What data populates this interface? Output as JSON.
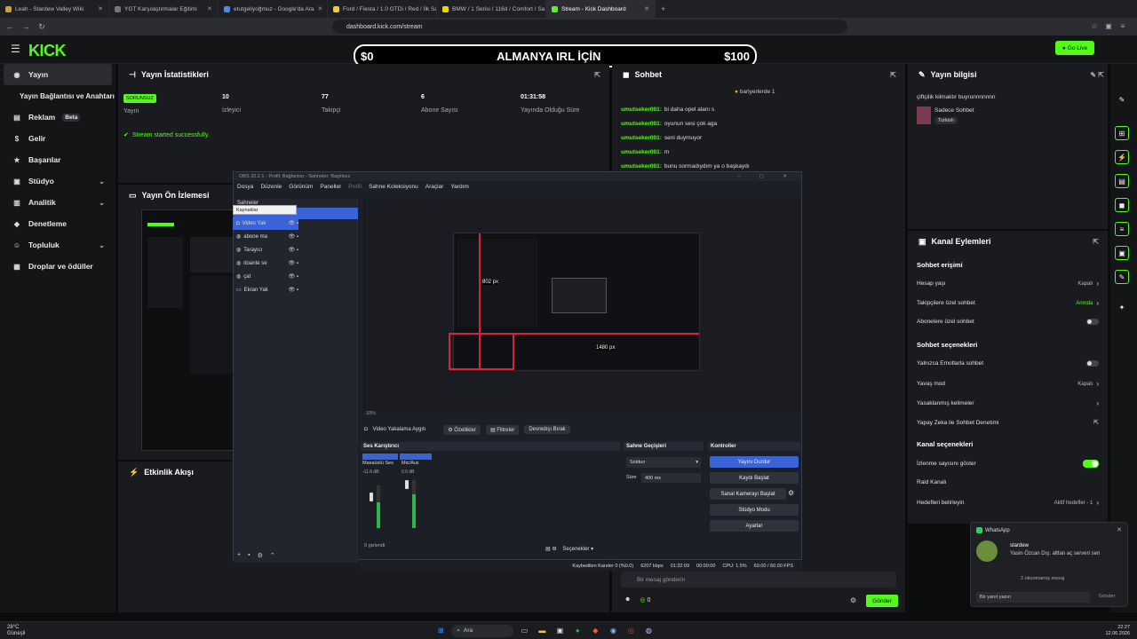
{
  "browser": {
    "tabs": [
      {
        "title": "Leah - Stardew Valley Wiki",
        "color": "#c9a43a"
      },
      {
        "title": "YGT Karşılaştırmalar Eğitimi",
        "color": "#777"
      },
      {
        "title": "etutgeliyoğmuz - Google'da Ara",
        "color": "#4a8af4"
      },
      {
        "title": "Ford / Fiesta / 1.0 GTDi / Red / İlk Sa",
        "color": "#f5d300"
      },
      {
        "title": "BMW / 1 Serisi / 116d / Comfort / Sa",
        "color": "#f5d300"
      },
      {
        "title": "Stream - Kick Dashboard",
        "color": "#53fc18"
      }
    ],
    "url": "dashboard.kick.com/stream"
  },
  "header": {
    "logo": "KICK",
    "banner_left": "$0",
    "banner_title": "ALMANYA IRL İÇİN",
    "banner_right": "$100",
    "golive_label": "Go Live"
  },
  "sidebar": {
    "items": [
      {
        "label": "Yayın",
        "icon": "broadcast-icon",
        "glyph": "◉",
        "active": true
      },
      {
        "label": "Yayın Bağlantısı ve Anahtarı",
        "sub": true
      },
      {
        "label": "Reklam",
        "icon": "ad-icon",
        "glyph": "▤",
        "badge": "Beta"
      },
      {
        "label": "Gelir",
        "icon": "revenue-icon",
        "glyph": "$"
      },
      {
        "label": "Başarılar",
        "icon": "trophy-icon",
        "glyph": "★"
      },
      {
        "label": "Stüdyo",
        "icon": "studio-icon",
        "glyph": "▣",
        "chev": true
      },
      {
        "label": "Analitik",
        "icon": "chart-icon",
        "glyph": "▥",
        "chev": true
      },
      {
        "label": "Denetleme",
        "icon": "shield-icon",
        "glyph": "◆"
      },
      {
        "label": "Topluluk",
        "icon": "users-icon",
        "glyph": "☺",
        "chev": true
      },
      {
        "label": "Droplar ve ödüller",
        "icon": "gift-icon",
        "glyph": "▦"
      }
    ]
  },
  "stats": {
    "title": "Yayın İstatistikleri",
    "status_badge": "SORUNSUZ",
    "status_label": "Yayın",
    "items": [
      {
        "value": "10",
        "label": "İzleyici"
      },
      {
        "value": "77",
        "label": "Takipçi"
      },
      {
        "value": "6",
        "label": "Abone Sayısı"
      },
      {
        "value": "01:31:58",
        "label": "Yayında Olduğu Süre"
      }
    ],
    "started": "Stream started successfully."
  },
  "preview": {
    "title": "Yayın Ön İzlemesi"
  },
  "events": {
    "title": "Etkinlik Akışı"
  },
  "chat": {
    "title": "Sohbet",
    "pinned": "barlyerlerde 1",
    "messages": [
      {
        "user": "umutseker001:",
        "text": "bi daha opel alanı s"
      },
      {
        "user": "umutseker001:",
        "text": "oyunun sesi çok aga"
      },
      {
        "user": "umutseker001:",
        "text": "seni duymuyor"
      },
      {
        "user": "umutseker001:",
        "text": "m"
      },
      {
        "user": "umutseker001:",
        "text": "bunu sormadıydım ya o başkaydı"
      }
    ],
    "input_placeholder": "Bir mesaj gönderin",
    "send_label": "Gönder",
    "count": "0"
  },
  "info": {
    "title": "Yayın bilgisi",
    "stream_title": "çiftçilik kilmaktır buyrunnnnnnn",
    "category": "Sadece Sohbet",
    "language": "Turkish"
  },
  "actions": {
    "title": "Kanal Eylemleri",
    "chat_access": "Sohbet erişimi",
    "rows1": [
      {
        "label": "Hesap yaşı",
        "value": "Kapalı",
        "kind": "chev"
      },
      {
        "label": "Takipçilere özel sohbet",
        "value": "Anında",
        "kind": "chev",
        "green": true
      },
      {
        "label": "Abonelere özel sohbet",
        "value": "",
        "kind": "toggle"
      }
    ],
    "chat_options": "Sohbet seçenekleri",
    "rows2": [
      {
        "label": "Yalnızca Emotlarla sohbet",
        "value": "",
        "kind": "toggle"
      },
      {
        "label": "Yavaş mod",
        "value": "Kapalı",
        "kind": "chev"
      },
      {
        "label": "Yasaklanmış kelimeler",
        "value": "",
        "kind": "chev"
      },
      {
        "label": "Yapay Zeka ile Sohbet Denetimi",
        "value": "",
        "kind": "ext"
      }
    ],
    "channel_options": "Kanal seçenekleri",
    "rows3": [
      {
        "label": "İzlenme sayısını göster",
        "value": "",
        "kind": "toggle-on"
      },
      {
        "label": "Raid Kanalı",
        "value": "",
        "kind": "none"
      },
      {
        "label": "Hedefleri belirleyin",
        "value": "Aktif hedefler - 1",
        "kind": "chev"
      }
    ]
  },
  "obs": {
    "title": "OBS 32.2.1 - Profil: Bağlantısı - Sahneler: Başlıksız",
    "menu": [
      "Dosya",
      "Düzenle",
      "Görünüm",
      "Paneller",
      "Profil",
      "Sahne Koleksiyonu",
      "Araçlar",
      "Yardım"
    ],
    "scenes_label": "Sahneler",
    "sources_tip": "Kaynaklar",
    "sources": [
      {
        "name": "Video Yak",
        "icon": "camera-icon",
        "glyph": "◘",
        "selected": true
      },
      {
        "name": "abone ma",
        "icon": "globe-icon",
        "glyph": "◍"
      },
      {
        "name": "Tarayıcı",
        "icon": "globe-icon",
        "glyph": "◍"
      },
      {
        "name": "doante se",
        "icon": "globe-icon",
        "glyph": "◍"
      },
      {
        "name": "çat",
        "icon": "globe-icon",
        "glyph": "◍"
      },
      {
        "name": "Ekran Yak",
        "icon": "monitor-icon",
        "glyph": "▭"
      }
    ],
    "canvas_label_1": "802 px",
    "canvas_label_2": "1480 px",
    "zoom": "33%",
    "toolbar": {
      "source_name": "Video Yakalama Aygıtı",
      "properties": "Özellikler",
      "filters": "Filtreler",
      "deactivate": "Devredışı Bırak"
    },
    "mixer": {
      "title": "Ses Karıştırıcı",
      "ch1": "Masaüstü Ses",
      "ch2": "Mic/Aux",
      "ch1_db": "-11.6 dB",
      "ch2_db": "0.0 dB",
      "hidden": "0 gizlendi"
    },
    "transitions": {
      "title": "Sahne Geçişleri",
      "type": "Solduır",
      "duration_label": "Süre",
      "duration": "400 ms"
    },
    "controls": {
      "title": "Kontroller",
      "buttons": [
        "Yayını Durdur",
        "Kaydı Başlat",
        "Sanal Kamerayı Başlat",
        "Stüdyo Modu",
        "Ayarlar"
      ]
    },
    "options_label": "Seçenekler",
    "status": {
      "dropped": "Kaybedilen Kareler 0 (%0.0)",
      "bitrate": "6207 kbps",
      "live_time": "01:32:09",
      "rec_time": "00:00:00",
      "cpu": "CPU: 1.5%",
      "fps": "60.00 / 60.00 FPS"
    }
  },
  "whatsapp": {
    "app": "WhatsApp",
    "sender": "stardew",
    "message": "Yasin Özcan Dış: alttan aç serveri sen",
    "unread": "2 okunmamış mesaj",
    "reply_placeholder": "Bir yanıt yazın",
    "send": "Gönder"
  },
  "taskbar": {
    "weather_temp": "28°C",
    "weather_desc": "Güneşli",
    "search": "Ara",
    "time": "22:27",
    "date": "12.06.2026"
  },
  "colors": {
    "kick_green": "#53fc18",
    "obs_blue": "#3a63d6"
  }
}
